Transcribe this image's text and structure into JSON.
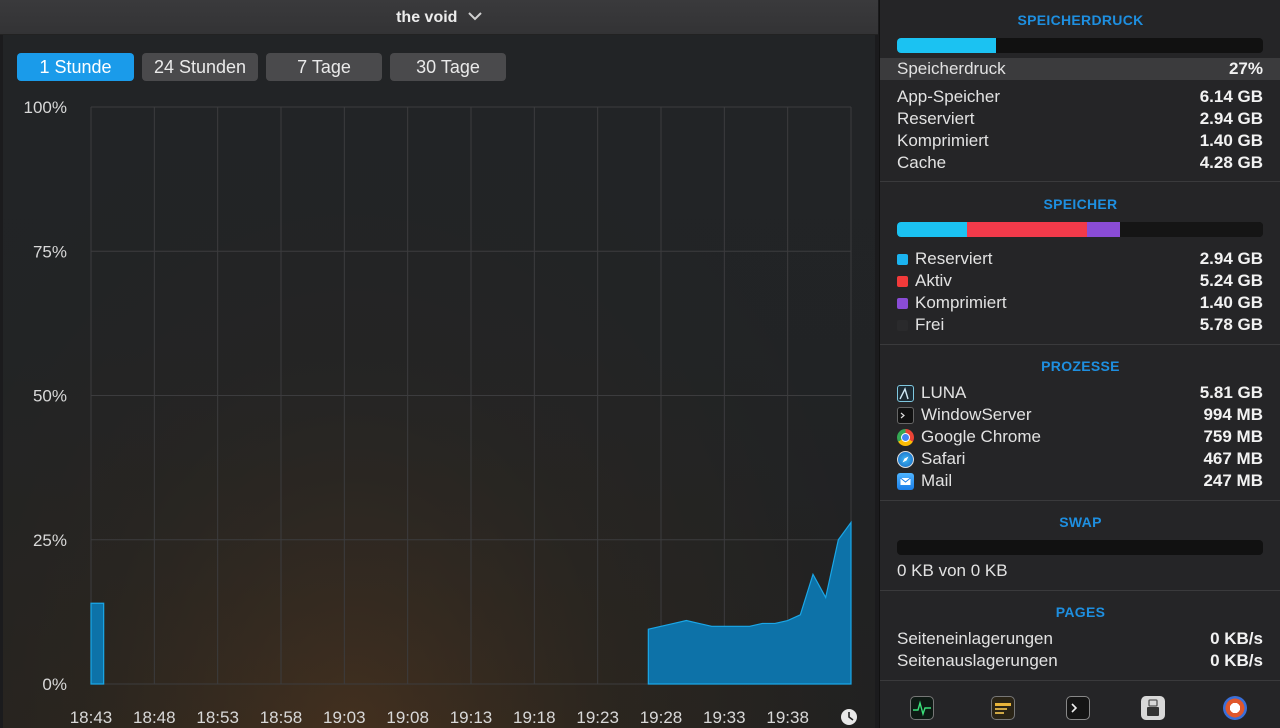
{
  "window": {
    "title": "the void"
  },
  "tabs": [
    {
      "label": "1 Stunde",
      "active": true
    },
    {
      "label": "24 Stunden",
      "active": false
    },
    {
      "label": "7 Tage",
      "active": false
    },
    {
      "label": "30 Tage",
      "active": false
    }
  ],
  "chart_data": {
    "type": "area",
    "ylim": [
      0,
      100
    ],
    "y_ticks": [
      "100%",
      "75%",
      "50%",
      "25%",
      "0%"
    ],
    "x_ticks": [
      "18:43",
      "18:48",
      "18:53",
      "18:58",
      "19:03",
      "19:08",
      "19:13",
      "19:18",
      "19:23",
      "19:28",
      "19:33",
      "19:38"
    ],
    "x_start": "18:43",
    "x_end": "19:43",
    "series": [
      {
        "color": "#0d72a8",
        "points": [
          [
            "18:43",
            14
          ],
          [
            "18:44",
            14
          ],
          [
            "19:27",
            9.5
          ],
          [
            "19:28",
            10
          ],
          [
            "19:29",
            10.5
          ],
          [
            "19:30",
            11
          ],
          [
            "19:31",
            10.5
          ],
          [
            "19:32",
            10
          ],
          [
            "19:33",
            10
          ],
          [
            "19:34",
            10
          ],
          [
            "19:35",
            10
          ],
          [
            "19:36",
            10.5
          ],
          [
            "19:37",
            10.5
          ],
          [
            "19:38",
            11
          ],
          [
            "19:39",
            12
          ],
          [
            "19:40",
            19
          ],
          [
            "19:41",
            15
          ],
          [
            "19:42",
            25
          ],
          [
            "19:43",
            28
          ]
        ]
      }
    ]
  },
  "memory_pressure": {
    "title": "SPEICHERDRUCK",
    "percent": 27,
    "label": "Speicherdruck",
    "value": "27%",
    "rows": [
      {
        "label": "App-Speicher",
        "value": "6.14 GB"
      },
      {
        "label": "Reserviert",
        "value": "2.94 GB"
      },
      {
        "label": "Komprimiert",
        "value": "1.40 GB"
      },
      {
        "label": "Cache",
        "value": "4.28 GB"
      }
    ]
  },
  "memory": {
    "title": "SPEICHER",
    "segments": [
      {
        "color": "#1bc2f2",
        "fraction": 0.19
      },
      {
        "color": "#f23a4a",
        "fraction": 0.33
      },
      {
        "color": "#8a4cd6",
        "fraction": 0.09
      },
      {
        "color": "#151515",
        "fraction": 0.39
      }
    ],
    "rows": [
      {
        "label": "Reserviert",
        "value": "2.94 GB",
        "color": "#1bb4f0"
      },
      {
        "label": "Aktiv",
        "value": "5.24 GB",
        "color": "#f23a3a"
      },
      {
        "label": "Komprimiert",
        "value": "1.40 GB",
        "color": "#8a4cd6"
      },
      {
        "label": "Frei",
        "value": "5.78 GB",
        "color": "#2a2a2c"
      }
    ]
  },
  "processes": {
    "title": "PROZESSE",
    "rows": [
      {
        "label": "LUNA",
        "value": "5.81 GB",
        "icon": "luna-app-icon"
      },
      {
        "label": "WindowServer",
        "value": "994 MB",
        "icon": "terminal-icon"
      },
      {
        "label": "Google Chrome",
        "value": "759 MB",
        "icon": "chrome-icon"
      },
      {
        "label": "Safari",
        "value": "467 MB",
        "icon": "safari-icon"
      },
      {
        "label": "Mail",
        "value": "247 MB",
        "icon": "mail-icon"
      }
    ]
  },
  "swap": {
    "title": "SWAP",
    "text": "0 KB von 0 KB",
    "fraction": 0
  },
  "pages": {
    "title": "PAGES",
    "rows": [
      {
        "label": "Seiteneinlagerungen",
        "value": "0 KB/s"
      },
      {
        "label": "Seitenauslagerungen",
        "value": "0 KB/s"
      }
    ]
  },
  "dock": [
    "activity-monitor-icon",
    "console-icon",
    "terminal-icon",
    "system-info-icon",
    "disk-utility-icon"
  ]
}
